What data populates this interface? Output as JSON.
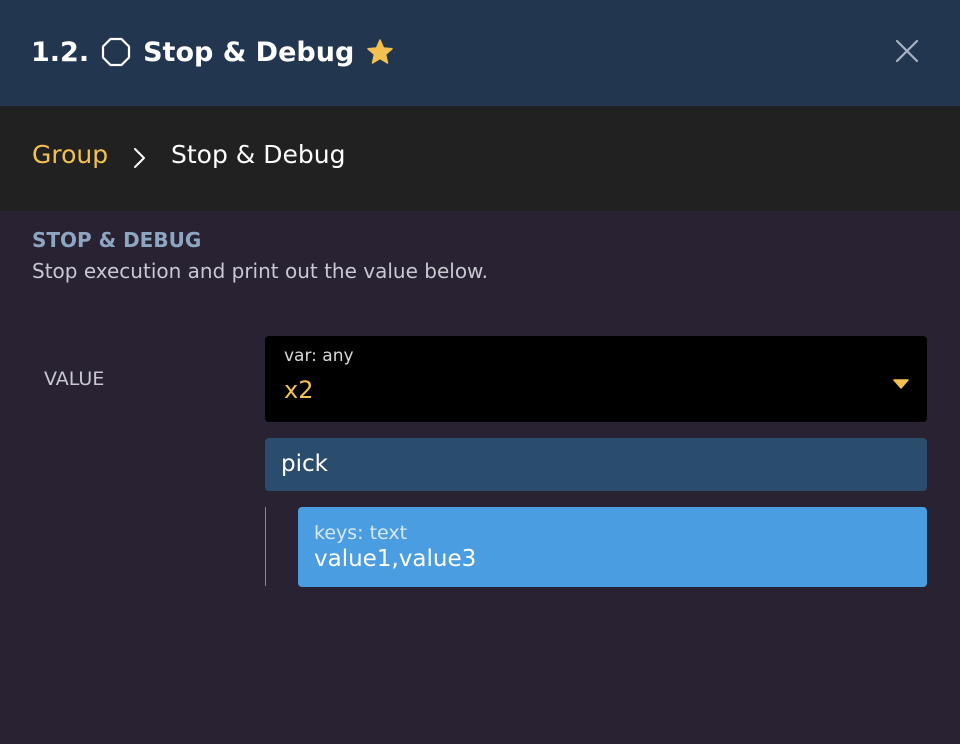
{
  "header": {
    "number": "1.2.",
    "title": "Stop & Debug",
    "icons": [
      "octagon-icon",
      "star-icon",
      "close-icon"
    ],
    "star_color": "#F3C14F"
  },
  "breadcrumb": {
    "parent": "Group",
    "current": "Stop & Debug",
    "separator_icon": "chevron-right-icon"
  },
  "section": {
    "title": "STOP & DEBUG",
    "description": "Stop execution and print out the value below."
  },
  "field": {
    "label": "VALUE",
    "variable": {
      "type_label": "var: any",
      "value": "x2",
      "dropdown_icon": "caret-down-icon"
    },
    "operation": {
      "label": "pick"
    },
    "keys": {
      "type_label": "keys: text",
      "value": "value1,value3"
    }
  },
  "colors": {
    "header_bg": "#233650",
    "breadcrumb_bg": "#212121",
    "body_bg": "#282232",
    "accent": "#F3C14F",
    "section_title": "#8DA6C2",
    "pick_bg": "#2B4D6D",
    "keys_bg": "#4A9DE0"
  }
}
